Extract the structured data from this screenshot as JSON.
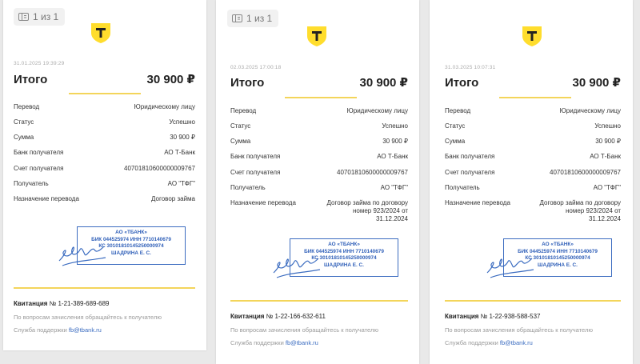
{
  "pager": "1 из 1",
  "total_label": "Итого",
  "labels": {
    "transfer": "Перевод",
    "status": "Статус",
    "sum": "Сумма",
    "bank": "Банк получателя",
    "account": "Счет получателя",
    "recipient": "Получатель",
    "purpose": "Назначение перевода",
    "receipt": "Квитанция",
    "note": "По вопросам зачисления обращайтесь к получателю",
    "support": "Служба поддержки"
  },
  "stamp": {
    "line1": "АО «ТБАНК»",
    "line2": "БИК 044525974 ИНН 7710140679",
    "line3": "КС 30101810145250000974",
    "line4": "ШАДРИНА Е. С."
  },
  "support_email": "fb@tbank.ru",
  "receipts": [
    {
      "timestamp": "31.01.2025 19:39:29",
      "amount": "30 900 ₽",
      "transfer": "Юридическому лицу",
      "status": "Успешно",
      "sum": "30 900 ₽",
      "bank": "АО Т-Банк",
      "account": "40701810600000009767",
      "recipient": "АО \"ТФГ\"",
      "purpose": "Договор займа",
      "receipt_no": "№ 1-21-389-689-689"
    },
    {
      "timestamp": "02.03.2025 17:00:18",
      "amount": "30 900 ₽",
      "transfer": "Юридическому лицу",
      "status": "Успешно",
      "sum": "30 900 ₽",
      "bank": "АО Т-Банк",
      "account": "40701810600000009767",
      "recipient": "АО \"ТФГ\"",
      "purpose": "Договор займа по договору номер 923/2024 от 31.12.2024",
      "receipt_no": "№ 1-22-166-632-611"
    },
    {
      "timestamp": "31.03.2025 10:07:31",
      "amount": "30 900 ₽",
      "transfer": "Юридическому лицу",
      "status": "Успешно",
      "sum": "30 900 ₽",
      "bank": "АО Т-Банк",
      "account": "40701810600000009767",
      "recipient": "АО \"ТФГ\"",
      "purpose": "Договор займа по договору номер 923/2024 от 31.12.2024",
      "receipt_no": "№ 1-22-938-588-537"
    }
  ],
  "colors": {
    "brand_yellow": "#ffdd2d",
    "accent_line": "#f3d55b",
    "stamp_blue": "#2f5fb8"
  }
}
